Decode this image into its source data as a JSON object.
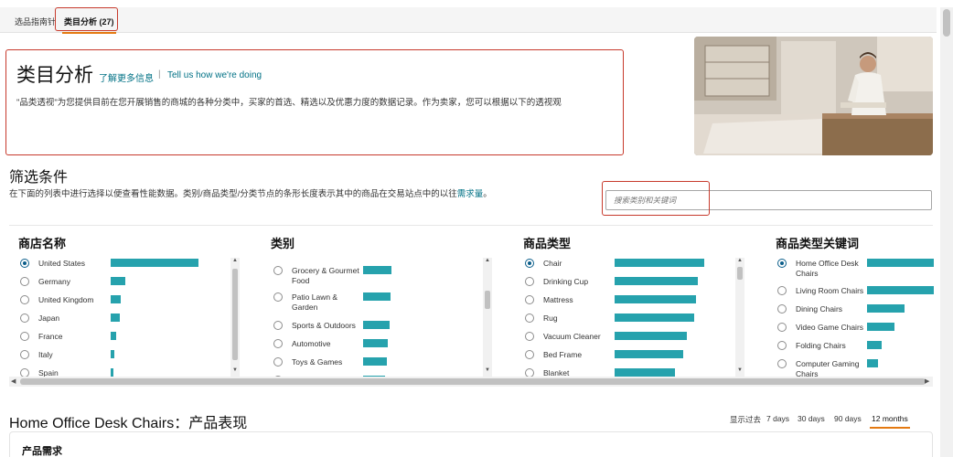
{
  "tabs": [
    {
      "label": "选品指南针"
    },
    {
      "label": "类目分析 (27)"
    }
  ],
  "header": {
    "title": "类目分析",
    "link_learn_more": "了解更多信息",
    "separator": "|",
    "link_feedback": "Tell us how we're doing",
    "description": "\"品类透视\"为您提供目前在您开展销售的商城的各种分类中，买家的首选、精选以及优惠力度的数据记录。作为卖家，您可以根据以下的透视观"
  },
  "filter": {
    "title": "筛选条件",
    "description_prefix": "在下面的列表中进行选择以便查看性能数据。类别/商品类型/分类节点的条形长度表示其中的商品在交易站点中的以往",
    "description_link": "需求量",
    "description_suffix": "。",
    "search_placeholder": "搜索类别和关键词"
  },
  "columns": {
    "store": {
      "title": "商店名称",
      "items": [
        {
          "label": "United States",
          "level": 0.98,
          "selected": true
        },
        {
          "label": "Germany",
          "level": 0.16,
          "selected": false
        },
        {
          "label": "United Kingdom",
          "level": 0.11,
          "selected": false
        },
        {
          "label": "Japan",
          "level": 0.1,
          "selected": false
        },
        {
          "label": "France",
          "level": 0.06,
          "selected": false
        },
        {
          "label": "Italy",
          "level": 0.04,
          "selected": false
        },
        {
          "label": "Spain",
          "level": 0.03,
          "selected": false
        }
      ]
    },
    "category": {
      "title": "类别",
      "items": [
        {
          "label": "Grocery & Gourmet Food",
          "level": 0.98,
          "selected": false
        },
        {
          "label": "Patio Lawn & Garden",
          "level": 0.95,
          "selected": false
        },
        {
          "label": "Sports & Outdoors",
          "level": 0.9,
          "selected": false
        },
        {
          "label": "Automotive",
          "level": 0.85,
          "selected": false
        },
        {
          "label": "Toys & Games",
          "level": 0.8,
          "selected": false
        },
        {
          "label": "Pet Supplies",
          "level": 0.75,
          "selected": false
        }
      ]
    },
    "product_type": {
      "title": "商品类型",
      "items": [
        {
          "label": "Chair",
          "level": 0.98,
          "selected": true
        },
        {
          "label": "Drinking Cup",
          "level": 0.91,
          "selected": false
        },
        {
          "label": "Mattress",
          "level": 0.89,
          "selected": false
        },
        {
          "label": "Rug",
          "level": 0.87,
          "selected": false
        },
        {
          "label": "Vacuum Cleaner",
          "level": 0.79,
          "selected": false
        },
        {
          "label": "Bed Frame",
          "level": 0.75,
          "selected": false
        },
        {
          "label": "Blanket",
          "level": 0.66,
          "selected": false
        }
      ]
    },
    "keyword": {
      "title": "商品类型关键词",
      "items": [
        {
          "label": "Home Office Desk Chairs",
          "level": 0.98,
          "selected": true
        },
        {
          "label": "Living Room Chairs",
          "level": 0.98,
          "selected": false
        },
        {
          "label": "Dining Chairs",
          "level": 0.55,
          "selected": false
        },
        {
          "label": "Video Game Chairs",
          "level": 0.4,
          "selected": false
        },
        {
          "label": "Folding Chairs",
          "level": 0.22,
          "selected": false
        },
        {
          "label": "Computer Gaming Chairs",
          "level": 0.16,
          "selected": false
        }
      ]
    }
  },
  "performance": {
    "title": "Home Office Desk Chairs：产品表现",
    "range_label": "显示过去",
    "ranges": [
      "7 days",
      "30 days",
      "90 days",
      "12 months"
    ],
    "active_range": "12 months",
    "subsection": "产品需求"
  },
  "colors": {
    "bar": "#26a2ad",
    "link": "#007185",
    "highlight_box": "#c73a2c",
    "tab_underline": "#e47911"
  }
}
